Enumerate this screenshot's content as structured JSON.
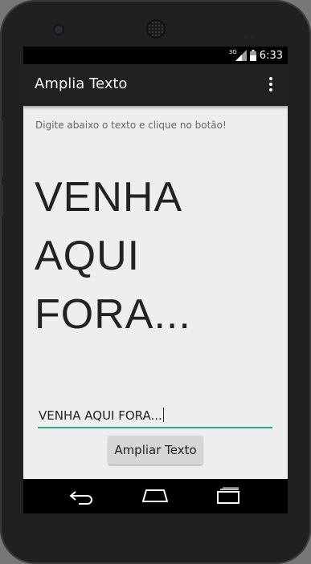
{
  "status_bar": {
    "network_label": "3G",
    "time": "6:33"
  },
  "action_bar": {
    "title": "Amplia Texto",
    "overflow_icon": "overflow-menu-icon"
  },
  "content": {
    "instruction": "Digite abaixo o texto e clique no botão!",
    "big_text_lines": [
      "VENHA",
      "AQUI",
      "FORA..."
    ],
    "input_value": "VENHA AQUI FORA...",
    "button_label": "Ampliar Texto"
  },
  "colors": {
    "action_bar_bg": "#212121",
    "content_bg": "#eeeeee",
    "input_underline": "#26a69a",
    "button_bg": "#d6d6d6"
  },
  "nav_bar": {
    "icons": [
      "back-icon",
      "home-icon",
      "recents-icon"
    ]
  }
}
